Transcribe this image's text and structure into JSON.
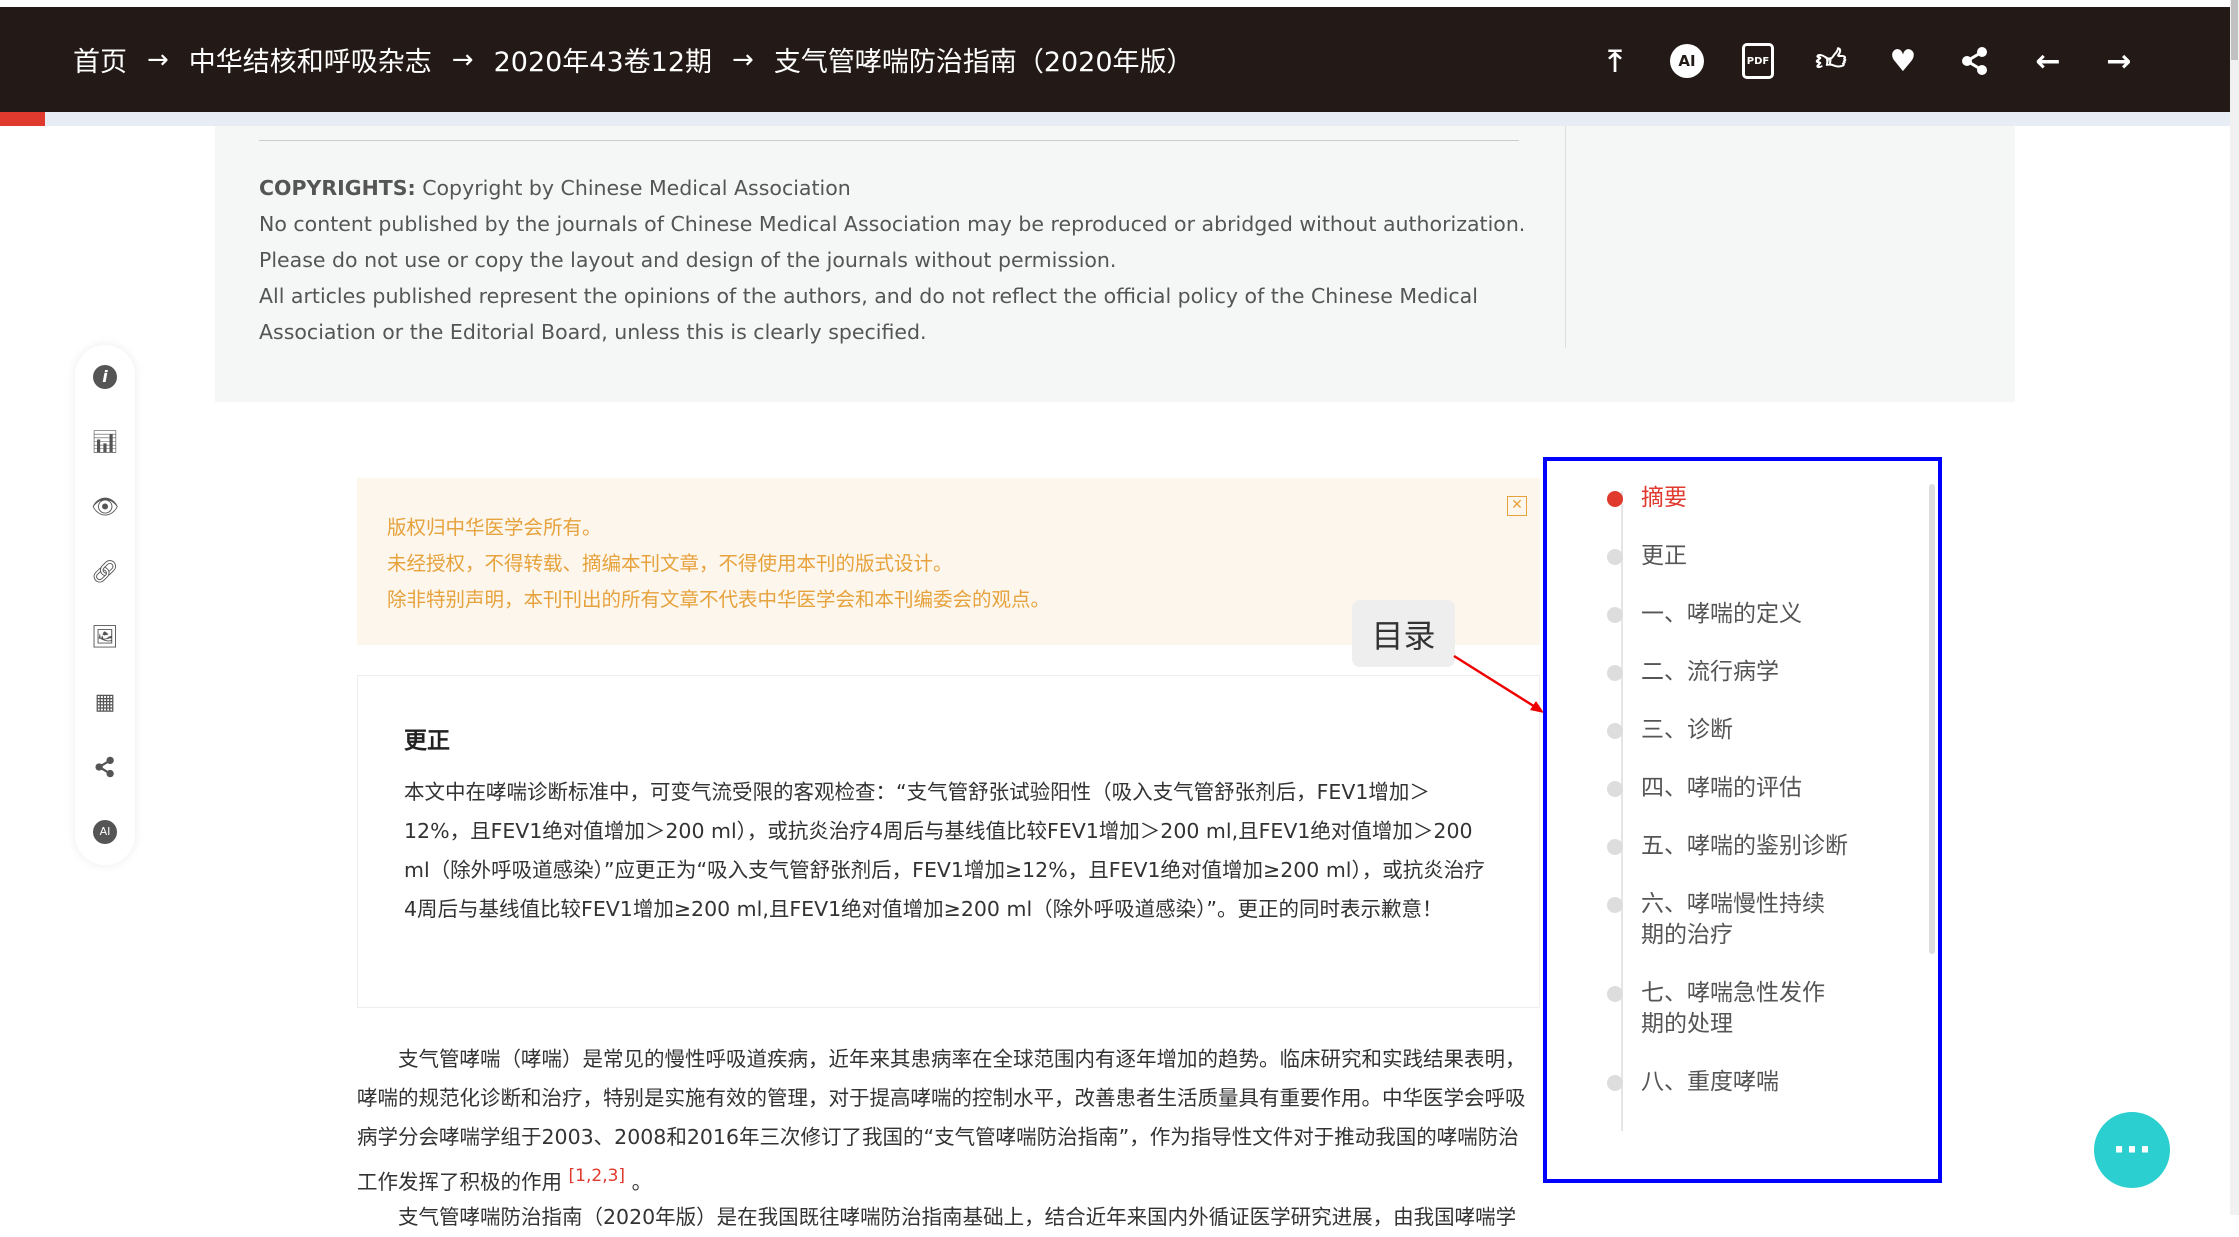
{
  "breadcrumb": [
    "首页",
    "中华结核和呼吸杂志",
    "2020年43卷12期",
    "支气管哮喘防治指南（2020年版）"
  ],
  "breadcrumb_separator": "→",
  "header_icons": [
    "back-to-top-icon",
    "ai-icon",
    "pdf-icon",
    "thumbs-up-icon",
    "heart-icon",
    "share-icon",
    "arrow-left-icon",
    "arrow-right-icon"
  ],
  "reading_progress_percent": 2,
  "copyright": {
    "label": "COPYRIGHTS:",
    "label_rest": " Copyright by Chinese Medical Association",
    "lines": [
      "No content published by the journals of Chinese Medical Association may be reproduced or abridged without authorization.",
      "Please do not use or copy the layout and design of the journals without permission.",
      "All articles published represent the opinions of the authors, and do not reflect the official policy of the Chinese Medical Association or the Editorial Board, unless this is clearly specified."
    ]
  },
  "side_toolbar": [
    "info-icon",
    "chart-icon",
    "eye-icon",
    "link-icon",
    "image-icon",
    "table-icon",
    "share-icon",
    "ai-icon"
  ],
  "notice": [
    "版权归中华医学会所有。",
    "未经授权，不得转载、摘编本刊文章，不得使用本刊的版式设计。",
    "除非特别声明，本刊刊出的所有文章不代表中华医学会和本刊编委会的观点。"
  ],
  "correction": {
    "title": "更正",
    "body": "本文中在哮喘诊断标准中，可变气流受限的客观检查：“支气管舒张试验阳性（吸入支气管舒张剂后，FEV1增加＞12%，且FEV1绝对值增加＞200 ml），或抗炎治疗4周后与基线值比较FEV1增加＞200 ml,且FEV1绝对值增加＞200 ml（除外呼吸道感染）”应更正为“吸入支气管舒张剂后，FEV1增加≥12%，且FEV1绝对值增加≥200 ml），或抗炎治疗4周后与基线值比较FEV1增加≥200 ml,且FEV1绝对值增加≥200 ml（除外呼吸道感染）”。更正的同时表示歉意！"
  },
  "intro": {
    "text": "支气管哮喘（哮喘）是常见的慢性呼吸道疾病，近年来其患病率在全球范围内有逐年增加的趋势。临床研究和实践结果表明，哮喘的规范化诊断和治疗，特别是实施有效的管理，对于提高哮喘的控制水平，改善患者生活质量具有重要作用。中华医学会呼吸病学分会哮喘学组于2003、2008和2016年三次修订了我国的“支气管哮喘防治指南”，作为指导性文件对于推动我国的哮喘防治工作发挥了积极的作用",
    "refs": "[1,2,3]",
    "end": "。"
  },
  "intro2": "支气管哮喘防治指南（2020年版）是在我国既往哮喘防治指南基础上，结合近年来国内外循证医学研究进展，由我国哮喘学",
  "tooltip": "目录",
  "toc": {
    "active_index": 0,
    "items": [
      "摘要",
      "更正",
      "一、哮喘的定义",
      "二、流行病学",
      "三、诊断",
      "四、哮喘的评估",
      "五、哮喘的鉴别诊断",
      "六、哮喘慢性持续期的治疗",
      "七、哮喘急性发作期的处理",
      "八、重度哮喘"
    ]
  },
  "chat_icon": "chat-bubble-icon",
  "colors": {
    "header_bg": "#231a17",
    "accent_red": "#e03a2f",
    "notice_text": "#e6a23c",
    "highlight_box": "#0000ff",
    "chat_button": "#2bcfcf"
  }
}
